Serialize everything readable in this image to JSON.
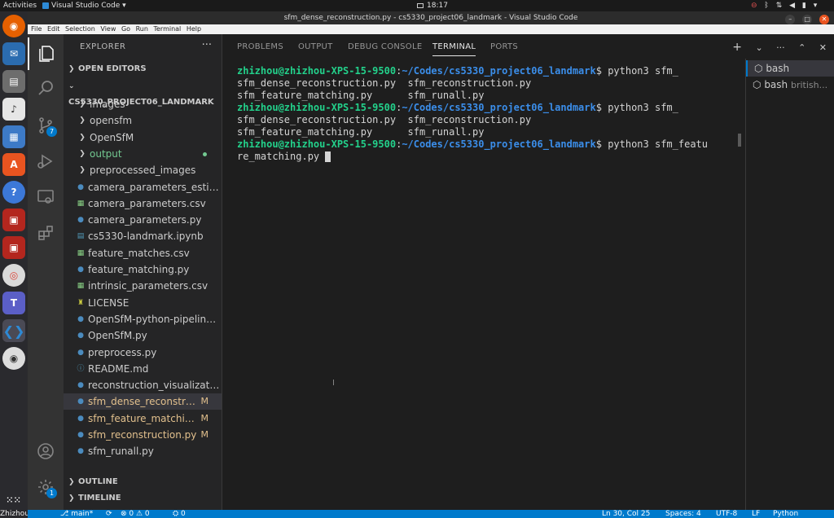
{
  "topbar": {
    "activities": "Activities",
    "app_name": "Visual Studio Code",
    "clock": "18:17"
  },
  "window": {
    "title": "sfm_dense_reconstruction.py - cs5330_project06_landmark - Visual Studio Code"
  },
  "menu": [
    "File",
    "Edit",
    "Selection",
    "View",
    "Go",
    "Run",
    "Terminal",
    "Help"
  ],
  "activity_bar": {
    "scm_badge": "7",
    "manage_badge": "1"
  },
  "explorer": {
    "title": "EXPLORER",
    "more": "···",
    "open_editors": "OPEN EDITORS",
    "project": "CS5330_PROJECT06_LANDMARK",
    "items": [
      {
        "label": "images",
        "type": "folder"
      },
      {
        "label": "opensfm",
        "type": "folder"
      },
      {
        "label": "OpenSfM",
        "type": "folder"
      },
      {
        "label": "output",
        "type": "folder"
      },
      {
        "label": "preprocessed_images",
        "type": "folder"
      },
      {
        "label": "camera_parameters_estim...",
        "type": "py"
      },
      {
        "label": "camera_parameters.csv",
        "type": "csv"
      },
      {
        "label": "camera_parameters.py",
        "type": "py"
      },
      {
        "label": "cs5330-landmark.ipynb",
        "type": "nb"
      },
      {
        "label": "feature_matches.csv",
        "type": "csv"
      },
      {
        "label": "feature_matching.py",
        "type": "py"
      },
      {
        "label": "intrinsic_parameters.csv",
        "type": "csv"
      },
      {
        "label": "LICENSE",
        "type": "lic"
      },
      {
        "label": "OpenSfM-python-pipeline.py",
        "type": "py"
      },
      {
        "label": "OpenSfM.py",
        "type": "py"
      },
      {
        "label": "preprocess.py",
        "type": "py"
      },
      {
        "label": "README.md",
        "type": "md"
      },
      {
        "label": "reconstruction_visualizatio...",
        "type": "py"
      },
      {
        "label": "sfm_dense_reconstru...",
        "type": "py",
        "status": "M"
      },
      {
        "label": "sfm_feature_matchin...",
        "type": "py",
        "status": "M"
      },
      {
        "label": "sfm_reconstruction.py",
        "type": "py",
        "status": "M"
      },
      {
        "label": "sfm_runall.py",
        "type": "py"
      }
    ],
    "outline": "OUTLINE",
    "timeline": "TIMELINE"
  },
  "panel": {
    "tabs": [
      "PROBLEMS",
      "OUTPUT",
      "DEBUG CONSOLE",
      "TERMINAL",
      "PORTS"
    ],
    "actions": {
      "add": "+",
      "chevron": "⌄",
      "more": "···",
      "close": "✕"
    }
  },
  "terminal": {
    "user": "zhizhou@zhizhou-XPS-15-9500",
    "path": "~/Codes/cs5330_project06_landmark",
    "lines": [
      {
        "kind": "prompt",
        "cmd": "python3 sfm_"
      },
      {
        "kind": "out",
        "text": "sfm_dense_reconstruction.py  sfm_reconstruction.py"
      },
      {
        "kind": "out",
        "text": "sfm_feature_matching.py      sfm_runall.py"
      },
      {
        "kind": "prompt",
        "cmd": "python3 sfm_"
      },
      {
        "kind": "out",
        "text": "sfm_dense_reconstruction.py  sfm_reconstruction.py"
      },
      {
        "kind": "out",
        "text": "sfm_feature_matching.py      sfm_runall.py"
      },
      {
        "kind": "prompt",
        "cmd": "python3 sfm_featu"
      },
      {
        "kind": "out",
        "text": "re_matching.py "
      }
    ],
    "list": [
      {
        "label": "bash",
        "sub": ""
      },
      {
        "label": "bash",
        "sub": "british..."
      }
    ]
  },
  "statusbar": {
    "branch": "main*",
    "sync": "⟳",
    "problems": "⊗ 0 ⚠ 0",
    "ports": "⛭ 0",
    "position": "Ln 30, Col 25",
    "spaces": "Spaces: 4",
    "encoding": "UTF-8",
    "eol": "LF",
    "language": "Python"
  },
  "os_user": "Zhizhou Gu"
}
